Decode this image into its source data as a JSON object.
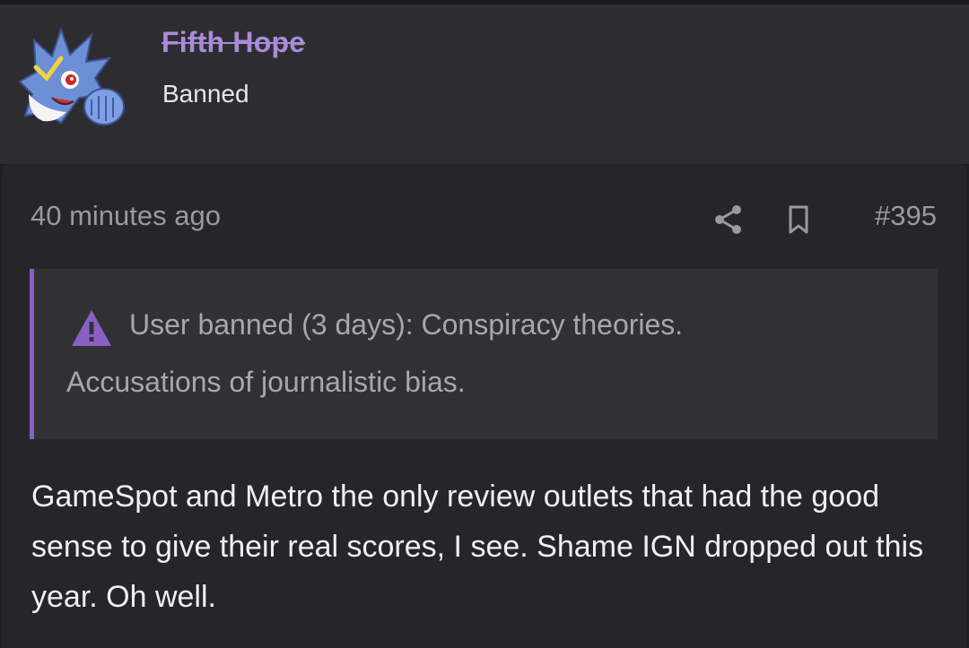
{
  "user": {
    "name": "Fifth Hope",
    "title": "Banned",
    "name_color": "#a98bd8"
  },
  "post": {
    "time": "40 minutes ago",
    "number": "#395",
    "share_icon": "share-icon",
    "bookmark_icon": "bookmark-icon",
    "ban_notice": {
      "icon": "warning-icon",
      "accent_color": "#8a5fc4",
      "line1": "User banned (3 days): Conspiracy theories.",
      "line2": "Accusations of journalistic bias."
    },
    "body": "GameSpot and Metro the only review outlets that had the good sense to give their real scores, I see. Shame IGN dropped out this year. Oh well."
  }
}
